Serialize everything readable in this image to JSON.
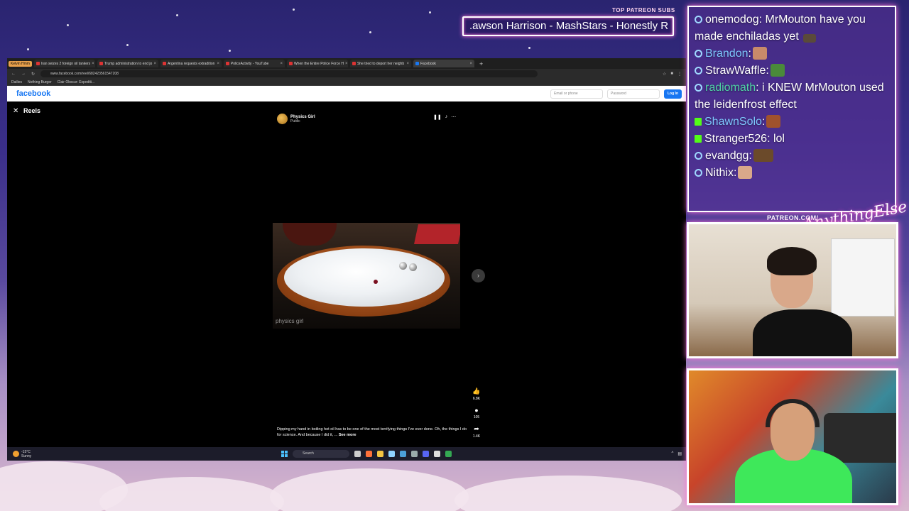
{
  "overlay": {
    "ticker_label": "TOP PATREON SUBS",
    "ticker_text": ".awson Harrison - MashStars - Honestly R",
    "patreon_url": "PATREON.COM/",
    "brand_script": "AnythingElse"
  },
  "browser": {
    "tab_group": "Kelvin Hmm",
    "tabs": [
      {
        "label": "Iran seizes 2 foreign oil tankers",
        "icon": "youtube-icon"
      },
      {
        "label": "Trump administration to end jo",
        "icon": "youtube-icon"
      },
      {
        "label": "Argentina requests extradition",
        "icon": "youtube-icon"
      },
      {
        "label": "PoliceActivity - YouTube",
        "icon": "youtube-icon"
      },
      {
        "label": "When the Entire Police Force H",
        "icon": "youtube-icon"
      },
      {
        "label": "She tried to deport her neighb",
        "icon": "youtube-icon"
      },
      {
        "label": "Facebook",
        "icon": "facebook-icon",
        "active": true
      }
    ],
    "url": "www.facebook.com/reel/682423561547208",
    "bookmarks": [
      "Dailies",
      "Nothing Burger",
      "Clair Obscur: Expediti..."
    ]
  },
  "facebook": {
    "logo": "facebook",
    "email_placeholder": "Email or phone",
    "password_placeholder": "Password",
    "login_label": "Log In",
    "reels_title": "Reels",
    "author_name": "Physics Girl",
    "author_visibility": "Public",
    "watermark": "physics girl",
    "likes": "6.8K",
    "comments": "105",
    "shares": "1.4K",
    "caption": "Dipping my hand in boiling hot oil has to be one of the most terrifying things I've ever done. Oh, the things I do for science. And because I did it, ... ",
    "see_more": "See more"
  },
  "taskbar": {
    "temperature": "-15°C",
    "weather": "Sunny",
    "search_placeholder": "Search"
  },
  "chat": {
    "messages": [
      {
        "user": "onemodog",
        "text": "MrMouton have you made enchiladas yet",
        "badge": "circle",
        "color": "#ffffff"
      },
      {
        "user": "Brandon",
        "text": "",
        "badge": "circle",
        "color": "#7ec8ff"
      },
      {
        "user": "StrawWaffle",
        "text": "",
        "badge": "circle",
        "color": "#ffffff"
      },
      {
        "user": "radiomath",
        "text": "i KNEW MrMouton used the leidenfrost effect",
        "badge": "circle",
        "color": "#4fd1a6"
      },
      {
        "user": "ShawnSolo",
        "text": "",
        "badge": "kick",
        "color": "#7ec8ff"
      },
      {
        "user": "Stranger526",
        "text": "lol",
        "badge": "kick",
        "color": "#ffffff"
      },
      {
        "user": "evandgg",
        "text": "",
        "badge": "circle",
        "color": "#ffffff"
      },
      {
        "user": "Nithix",
        "text": "",
        "badge": "circle",
        "color": "#ffffff"
      }
    ]
  }
}
